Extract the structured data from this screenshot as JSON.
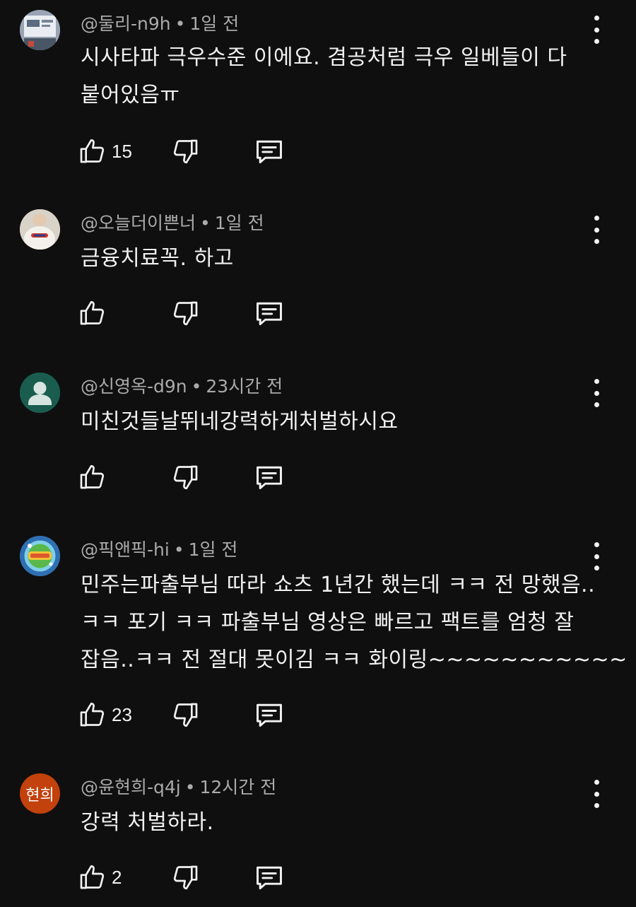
{
  "comments": [
    {
      "author": "@둘리-n9h",
      "separator": "•",
      "time": "1일 전",
      "lines": [
        "시사타파 극우수준 이에요. 겸공처럼 극우 일베들이 다",
        "붙어있음ㅠ"
      ],
      "likes": "15",
      "avatar_color": "#8a96a8"
    },
    {
      "author": "@오늘더이쁜너",
      "separator": "•",
      "time": "1일 전",
      "lines": [
        "금융치료꼭. 하고"
      ],
      "likes": "",
      "avatar_color": "#d8cfc4"
    },
    {
      "author": "@신영옥-d9n",
      "separator": "•",
      "time": "23시간 전",
      "lines": [
        "미친것들날뛰네강력하게처벌하시요"
      ],
      "likes": "",
      "avatar_color": "#1a5d4f"
    },
    {
      "author": "@픽앤픽-hi",
      "separator": "•",
      "time": "1일 전",
      "lines": [
        "민주는파출부님 따라 쇼츠 1년간 했는데 ㅋㅋ 전 망했음..",
        "ㅋㅋ 포기 ㅋㅋ 파출부님 영상은 빠르고 팩트를 엄청 잘",
        "잡음..ㅋㅋ 전 절대 못이김 ㅋㅋ 화이링~~~~~~~~~~~"
      ],
      "likes": "23",
      "avatar_color": "#3a7bbf"
    },
    {
      "author": "@윤현희-q4j",
      "separator": "•",
      "time": "12시간 전",
      "lines": [
        "강력 처벌하라."
      ],
      "likes": "2",
      "avatar_color": "#c2410c",
      "avatar_initials": "현희"
    }
  ],
  "icons": {
    "like": "thumbs-up-icon",
    "dislike": "thumbs-down-icon",
    "reply": "reply-icon",
    "more": "more-vertical-icon"
  }
}
